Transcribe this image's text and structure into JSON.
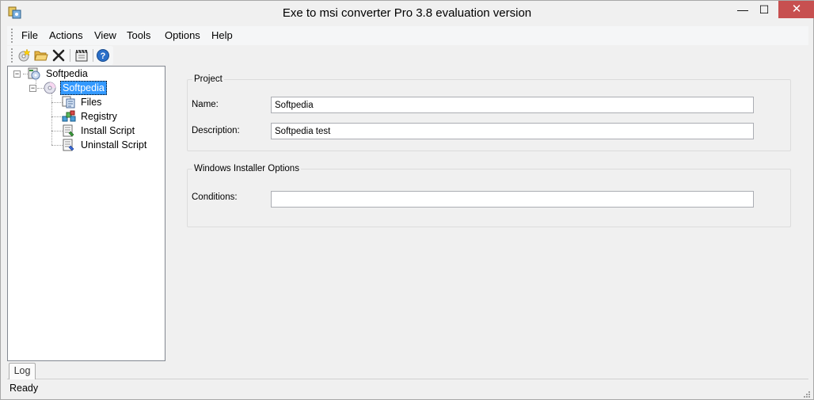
{
  "window": {
    "title": "Exe to msi converter Pro 3.8 evaluation version",
    "minimize_glyph": "—",
    "maximize_glyph": "☐",
    "close_glyph": "✕",
    "app_icon": "app-icon"
  },
  "menu": {
    "items": [
      {
        "label": "File"
      },
      {
        "label": "Actions"
      },
      {
        "label": "View"
      },
      {
        "label": "Tools"
      },
      {
        "label": "Options"
      },
      {
        "label": "Help"
      }
    ]
  },
  "toolbar": {
    "buttons": [
      {
        "icon": "new-project-icon"
      },
      {
        "icon": "open-folder-icon"
      },
      {
        "icon": "delete-icon"
      },
      {
        "icon": "build-icon"
      },
      {
        "icon": "help-icon"
      }
    ]
  },
  "tree": {
    "root": {
      "label": "Softpedia",
      "icon": "installer-icon"
    },
    "project": {
      "label": "Softpedia",
      "icon": "disc-icon",
      "selected": true
    },
    "children": [
      {
        "label": "Files",
        "icon": "files-icon"
      },
      {
        "label": "Registry",
        "icon": "registry-icon"
      },
      {
        "label": "Install Script",
        "icon": "install-script-icon"
      },
      {
        "label": "Uninstall Script",
        "icon": "uninstall-script-icon"
      }
    ]
  },
  "project_group": {
    "title": "Project",
    "name_label": "Name:",
    "name_value": "Softpedia",
    "description_label": "Description:",
    "description_value": "Softpedia test"
  },
  "installer_group": {
    "title": "Windows Installer Options",
    "conditions_label": "Conditions:",
    "conditions_value": ""
  },
  "log_tab": {
    "label": "Log"
  },
  "status": {
    "text": "Ready"
  },
  "colors": {
    "selection": "#3399ff",
    "close_button": "#c75050",
    "background": "#f0f0f0"
  }
}
